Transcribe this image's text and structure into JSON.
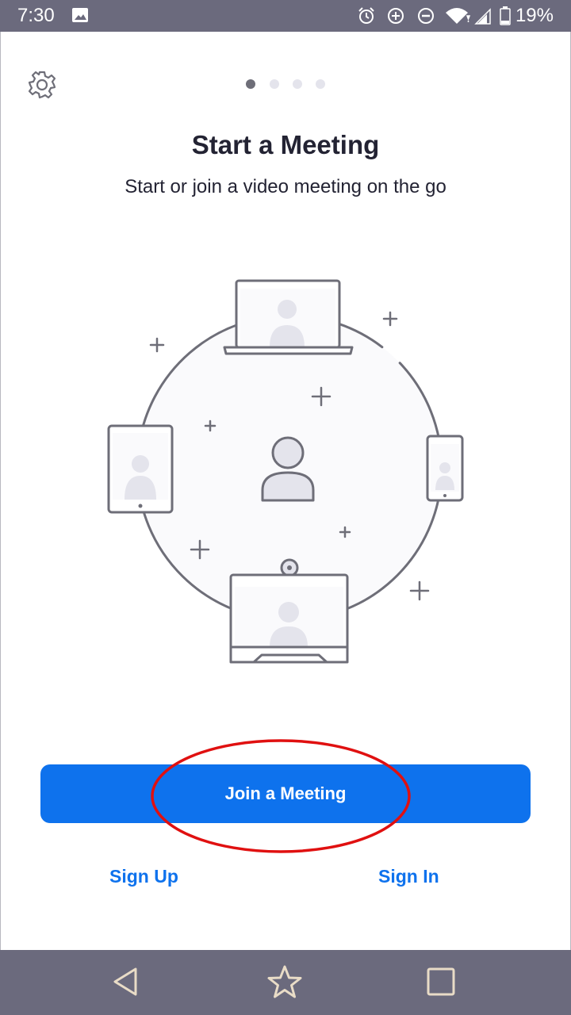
{
  "status_bar": {
    "time": "7:30",
    "battery": "19%",
    "icons": [
      "image-icon",
      "alarm-icon",
      "data-saver-icon",
      "do-not-disturb-icon",
      "wifi-icon",
      "cell-signal-icon",
      "battery-icon"
    ]
  },
  "onboarding": {
    "page_count": 4,
    "active_page": 1,
    "title": "Start a Meeting",
    "subtitle": "Start or join a video meeting on the go"
  },
  "actions": {
    "join_label": "Join a Meeting",
    "sign_up_label": "Sign Up",
    "sign_in_label": "Sign In"
  },
  "colors": {
    "accent": "#0e72ed",
    "system_bar": "#6b6a7d",
    "annotation": "#e01010",
    "text": "#232333"
  },
  "nav_bar": {
    "icons": [
      "back-icon",
      "home-star-icon",
      "recents-icon"
    ]
  }
}
